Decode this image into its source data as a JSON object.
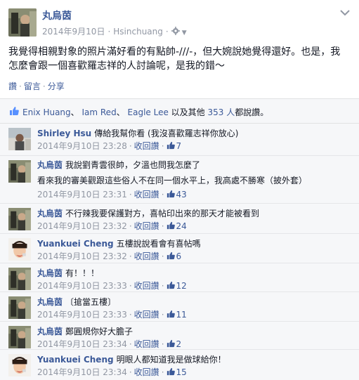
{
  "post": {
    "author": "丸烏茵",
    "date": "2014年9月10日",
    "location": "Hsinchuang",
    "text": "我覺得相親對象的照片滿好看的有點帥-///-，但大婉說她覺得還好。也是，我怎麼會跟一個喜歡羅志祥的人討論呢，是我的錯～",
    "actions": {
      "like": "讚",
      "comment": "留言",
      "share": "分享"
    },
    "menu_icon": "chevron-down-icon"
  },
  "likes": {
    "name1": "Enix Huang",
    "name2": "Iam Red",
    "name3": "Eagle Lee",
    "mid_text": "以及其他",
    "others_count": "353 人",
    "suffix": "都說讚。"
  },
  "comments": [
    {
      "name": "Shirley Hsu",
      "text": "傳給我幫你看 (我沒喜歡羅志祥你放心)",
      "time": "2014年9月10日 23:28",
      "unlike": "收回讚",
      "likes": "7"
    },
    {
      "name": "丸烏茵",
      "text": "我說劉青雲很帥，夕溫也問我怎麼了",
      "text2": "看來我的審美觀跟這些俗人不在同一個水平上，我高處不勝寒（披外套）",
      "time": "2014年9月10日 23:31",
      "unlike": "收回讚",
      "likes": "43"
    },
    {
      "name": "丸烏茵",
      "text": "不行辣我要保護對方，喜帖印出來的那天才能被看到",
      "time": "2014年9月10日 23:32",
      "unlike": "收回讚",
      "likes": "24"
    },
    {
      "name": "Yuankuei Cheng",
      "text": "五樓說說看會有喜帖嗎",
      "time": "2014年9月10日 23:32",
      "unlike": "收回讚",
      "likes": "6"
    },
    {
      "name": "丸烏茵",
      "text": "有！！！",
      "time": "2014年9月10日 23:33",
      "unlike": "收回讚",
      "likes": "12"
    },
    {
      "name": "丸烏茵",
      "text": "〔搶當五樓〕",
      "time": "2014年9月10日 23:33",
      "unlike": "收回讚",
      "likes": "11"
    },
    {
      "name": "丸烏茵",
      "text": "鄭圓規你好大膽子",
      "time": "2014年9月10日 23:34",
      "unlike": "收回讚",
      "likes": "2"
    },
    {
      "name": "Yuankuei Cheng",
      "text": "明眼人都知道我是做球給你！",
      "time": "2014年9月10日 23:34",
      "unlike": "收回讚",
      "likes": "15"
    }
  ],
  "colors": {
    "link": "#3b5998",
    "meta": "#9197a3",
    "bg_comments": "#f6f7f9"
  }
}
